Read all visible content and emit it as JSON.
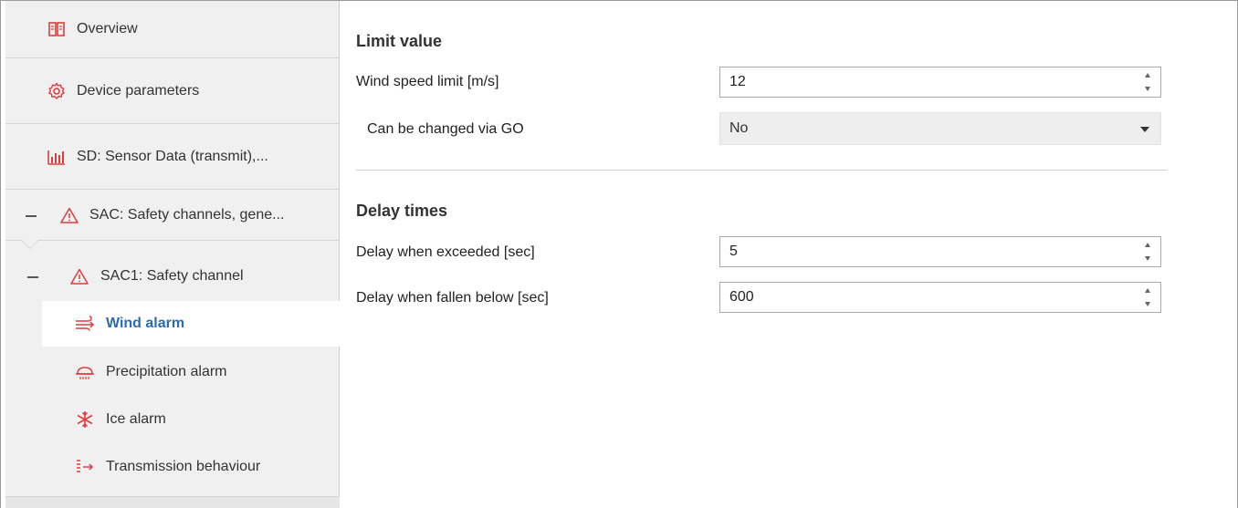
{
  "sidebar": {
    "items": [
      {
        "label": "Overview",
        "icon": "book-icon"
      },
      {
        "label": "Device parameters",
        "icon": "gear-icon"
      },
      {
        "label": "SD: Sensor Data (transmit),...",
        "icon": "bar-chart-icon"
      },
      {
        "label": "SAC: Safety channels, gene...",
        "icon": "warning-icon",
        "expanded": true
      }
    ],
    "subgroup": {
      "label": "SAC1:  Safety channel",
      "icon": "warning-icon",
      "expanded": true
    },
    "subitems": [
      {
        "label": "Wind alarm",
        "icon": "wind-icon",
        "active": true
      },
      {
        "label": "Precipitation alarm",
        "icon": "rain-icon"
      },
      {
        "label": "Ice alarm",
        "icon": "snowflake-icon"
      },
      {
        "label": "Transmission behaviour",
        "icon": "transmit-icon"
      }
    ]
  },
  "main": {
    "limit_section": {
      "title": "Limit value",
      "wind_speed_label": "Wind speed limit [m/s]",
      "wind_speed_value": "12",
      "changeable_label": "Can be changed via GO",
      "changeable_value": "No"
    },
    "delay_section": {
      "title": "Delay times",
      "exceeded_label": "Delay when exceeded [sec]",
      "exceeded_value": "5",
      "fallen_label": "Delay when fallen below [sec]",
      "fallen_value": "600"
    }
  },
  "colors": {
    "icon_red": "#e03c3c",
    "active_blue": "#2b6cb0",
    "sidebar_bg": "#f0f0f0"
  }
}
